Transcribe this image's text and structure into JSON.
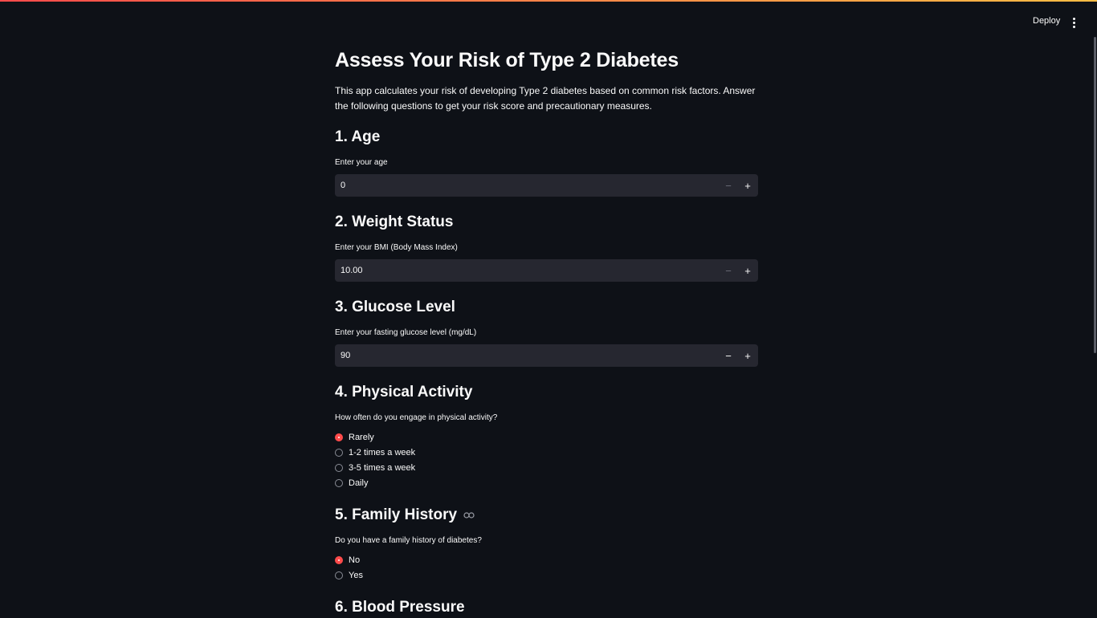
{
  "header": {
    "deploy_label": "Deploy",
    "menu_icon": "kebab-menu-icon"
  },
  "page": {
    "title": "Assess Your Risk of Type 2 Diabetes",
    "intro": "This app calculates your risk of developing Type 2 diabetes based on common risk factors. Answer the following questions to get your risk score and precautionary measures."
  },
  "sections": {
    "age": {
      "heading": "1. Age",
      "label": "Enter your age",
      "value": "0"
    },
    "weight": {
      "heading": "2. Weight Status",
      "label": "Enter your BMI (Body Mass Index)",
      "value": "10.00"
    },
    "glucose": {
      "heading": "3. Glucose Level",
      "label": "Enter your fasting glucose level (mg/dL)",
      "value": "90"
    },
    "activity": {
      "heading": "4. Physical Activity",
      "label": "How often do you engage in physical activity?",
      "options": [
        "Rarely",
        "1-2 times a week",
        "3-5 times a week",
        "Daily"
      ],
      "selected": "Rarely"
    },
    "family": {
      "heading": "5. Family History",
      "label": "Do you have a family history of diabetes?",
      "options": [
        "No",
        "Yes"
      ],
      "selected": "No"
    },
    "blood_pressure": {
      "heading": "6. Blood Pressure"
    }
  },
  "colors": {
    "accent": "#ff4b4b",
    "background": "#0e1117",
    "input_bg": "#262730"
  }
}
